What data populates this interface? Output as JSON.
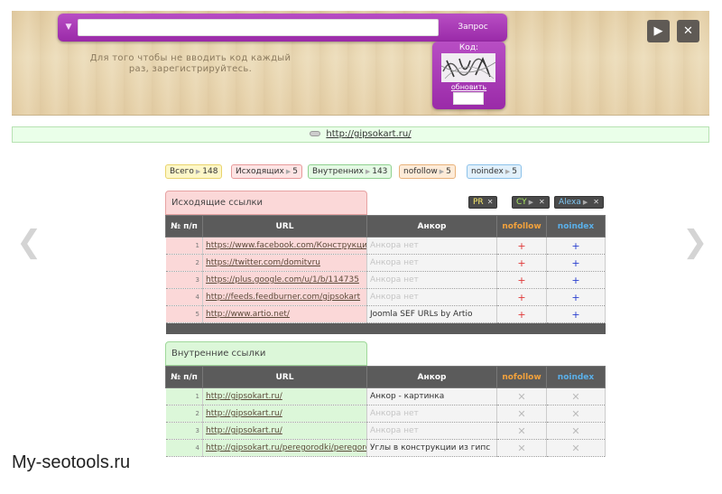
{
  "search": {
    "button_label": "Запрос",
    "value": "",
    "menu_icon": "dropdown-icon"
  },
  "register_note": "Для того чтобы не вводить код каждый раз, зарегистрируйтесь.",
  "captcha": {
    "label": "Код:",
    "refresh_label": "обновить"
  },
  "window_controls": {
    "play_icon": "play-icon",
    "close_icon": "close-icon"
  },
  "url_strip": {
    "url": "http://gipsokart.ru/"
  },
  "stats": [
    {
      "label": "Всего",
      "count": "148",
      "bg": "#fdf7c8",
      "border": "#e9d46c"
    },
    {
      "label": "Исходящих",
      "count": "5",
      "bg": "#fde4e4",
      "border": "#e79a9a"
    },
    {
      "label": "Внутренних",
      "count": "143",
      "bg": "#e4f9e4",
      "border": "#8fd18f"
    },
    {
      "label": "nofollow",
      "count": "5",
      "bg": "#fdebd8",
      "border": "#e8b27a"
    },
    {
      "label": "noindex",
      "count": "5",
      "bg": "#e1f0fb",
      "border": "#8cc2ea"
    }
  ],
  "filters": [
    {
      "label": "PR",
      "color": "#f7e86a"
    },
    {
      "label": "CY",
      "color": "#a8e860"
    },
    {
      "label": "Alexa",
      "color": "#7fc6f2"
    }
  ],
  "outgoing": {
    "title": "Исходящие ссылки",
    "columns": [
      "№ п/п",
      "URL",
      "Анкор",
      "nofollow",
      "noindex"
    ],
    "rows": [
      {
        "n": "1",
        "url": "https://www.facebook.com/Конструкции",
        "anchor": "Анкора нет",
        "muted": true
      },
      {
        "n": "2",
        "url": "https://twitter.com/domitvru",
        "anchor": "Анкора нет",
        "muted": true
      },
      {
        "n": "3",
        "url": "https://plus.google.com/u/1/b/114735",
        "anchor": "Анкора нет",
        "muted": true
      },
      {
        "n": "4",
        "url": "http://feeds.feedburner.com/gipsokart",
        "anchor": "Анкора нет",
        "muted": true
      },
      {
        "n": "5",
        "url": "http://www.artio.net/",
        "anchor": "Joomla SEF URLs by Artio",
        "muted": false
      }
    ]
  },
  "internal": {
    "title": "Внутренние ссылки",
    "columns": [
      "№ п/п",
      "URL",
      "Анкор",
      "nofollow",
      "noindex"
    ],
    "rows": [
      {
        "n": "1",
        "url": "http://gipsokart.ru/",
        "anchor": "Анкор - картинка",
        "muted": false
      },
      {
        "n": "2",
        "url": "http://gipsokart.ru/",
        "anchor": "Анкора нет",
        "muted": true
      },
      {
        "n": "3",
        "url": "http://gipsokart.ru/",
        "anchor": "Анкора нет",
        "muted": true
      },
      {
        "n": "4",
        "url": "http://gipsokart.ru/peregorodki/peregorodki",
        "anchor": "Углы в конструкции из гипс",
        "muted": false
      }
    ]
  },
  "watermark": "My-seotools.ru"
}
